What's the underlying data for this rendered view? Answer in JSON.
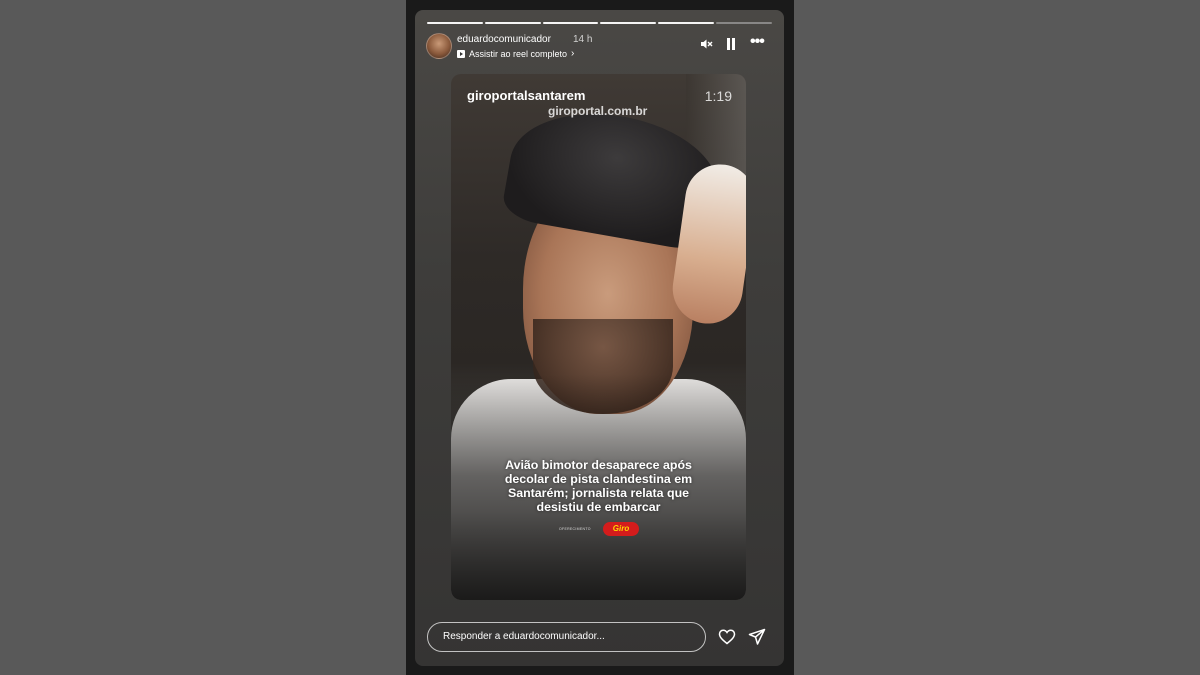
{
  "story": {
    "username": "eduardocomunicador",
    "time_ago": "14 h",
    "reel_link_label": "Assistir ao reel completo",
    "progress_segments": [
      1,
      1,
      1,
      1,
      1,
      0
    ]
  },
  "icons": {
    "mute": "muted-speaker-icon",
    "pause": "pause-icon",
    "more": "more-options-icon",
    "heart": "heart-icon",
    "send": "send-icon"
  },
  "video": {
    "watermark_handle": "giroportalsantarem",
    "watermark_url": "giroportal.com.br",
    "duration": "1:19",
    "headline": "Avião bimotor desaparece após decolar de pista clandestina em Santarém; jornalista relata que desistiu de embarcar",
    "sponsor_text": "OFERECIMENTO",
    "sponsor_logo": "Giro"
  },
  "reply": {
    "placeholder": "Responder a eduardocomunicador..."
  }
}
